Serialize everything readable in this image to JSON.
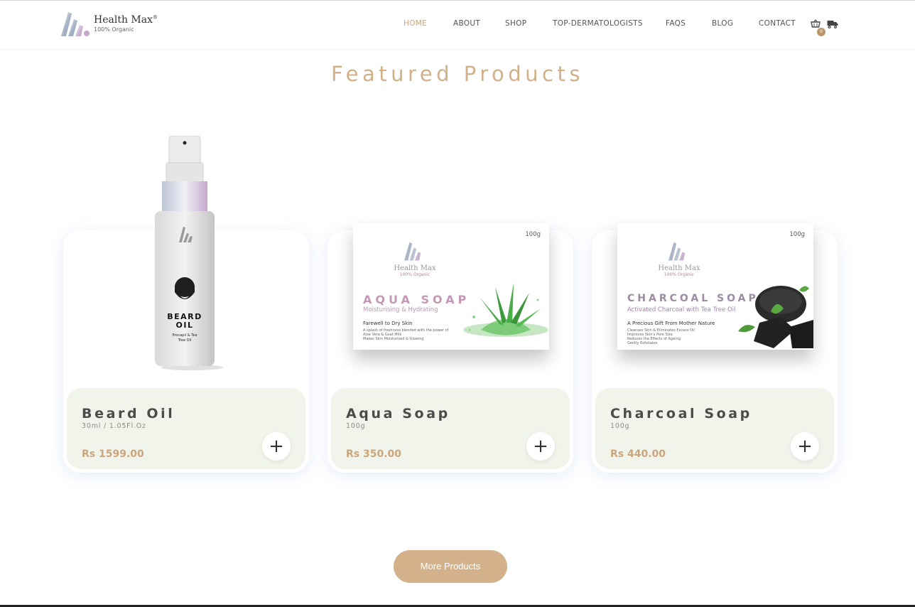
{
  "brand": {
    "name": "Health Max",
    "reg": "®",
    "tagline": "100% Organic"
  },
  "nav": {
    "items": [
      "HOME",
      "ABOUT",
      "SHOP",
      "TOP-DERMATOLOGISTS",
      "FAQS",
      "BLOG",
      "CONTACT"
    ],
    "active": "HOME",
    "cart_count": "0"
  },
  "section": {
    "title": "Featured Products"
  },
  "products": [
    {
      "name": "Beard Oil",
      "size": "30ml / 1.05Fl.Oz",
      "price": "Rs 1599.00",
      "label_title": "BEARD OIL",
      "label_sub": "Procapil & Tea Tree Oil"
    },
    {
      "name": "Aqua Soap",
      "size": "100g",
      "price": "Rs 350.00",
      "box_weight": "100g",
      "box_title": "AQUA SOAP",
      "box_sub": "Moisturising & Hydrating",
      "box_tag": "Farewell to Dry Skin",
      "box_lines": [
        "A splash of freshness blended with the power of",
        "Aloe Vera & Goat Milk",
        "Makes Skin Moisturised & Glowing"
      ]
    },
    {
      "name": "Charcoal Soap",
      "size": "100g",
      "price": "Rs 440.00",
      "box_weight": "100g",
      "box_title": "CHARCOAL SOAP",
      "box_sub": "Activated Charcoal with Tea Tree Oil",
      "box_tag": "A Precious Gift From Mother Nature",
      "box_lines": [
        "Cleanses Skin & Eliminates Excess Oil",
        "Improves Skin's Pore Size",
        "Reduces the Effects of Ageing",
        "Gently Exfoliates"
      ]
    }
  ],
  "more_button": "More Products",
  "colors": {
    "accent": "#c9a47b",
    "button": "#d2b18b",
    "card_info_bg": "#f1f4ea"
  }
}
